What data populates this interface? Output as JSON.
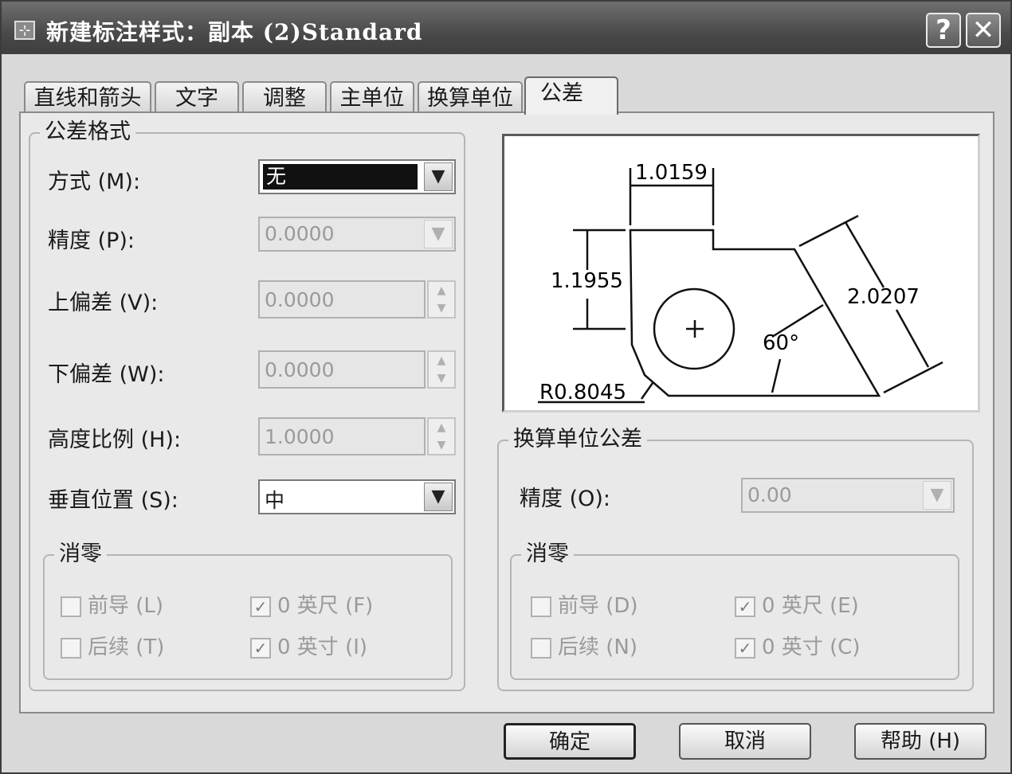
{
  "title": "新建标注样式：副本 (2)Standard",
  "title_icon": "dim-style-icon",
  "title_buttons": {
    "help": "?",
    "close": "✕"
  },
  "tabs": [
    {
      "label": "直线和箭头",
      "active": false
    },
    {
      "label": "文字",
      "active": false
    },
    {
      "label": "调整",
      "active": false
    },
    {
      "label": "主单位",
      "active": false
    },
    {
      "label": "换算单位",
      "active": false
    },
    {
      "label": "公差",
      "active": true
    }
  ],
  "tolerance_format": {
    "group_label": "公差格式",
    "method_label": "方式 (M):",
    "method_value": "无",
    "precision_label": "精度 (P):",
    "precision_value": "0.0000",
    "upper_label": "上偏差 (V):",
    "upper_value": "0.0000",
    "lower_label": "下偏差 (W):",
    "lower_value": "0.0000",
    "height_label": "高度比例 (H):",
    "height_value": "1.0000",
    "vertical_label": "垂直位置 (S):",
    "vertical_value": "中",
    "zero_group_label": "消零",
    "leading_label": "前导 (L)",
    "leading_checked": false,
    "trailing_label": "后续 (T)",
    "trailing_checked": false,
    "feet_label": "0 英尺 (F)",
    "feet_checked": true,
    "inches_label": "0 英寸 (I)",
    "inches_checked": true
  },
  "preview": {
    "dim_top": "1.0159",
    "dim_left": "1.1955",
    "dim_diag": "2.0207",
    "dim_angle": "60°",
    "dim_radius": "R0.8045"
  },
  "alt_tolerance": {
    "group_label": "换算单位公差",
    "precision_label": "精度 (O):",
    "precision_value": "0.00",
    "zero_group_label": "消零",
    "leading_label": "前导 (D)",
    "leading_checked": false,
    "trailing_label": "后续 (N)",
    "trailing_checked": false,
    "feet_label": "0 英尺 (E)",
    "feet_checked": true,
    "inches_label": "0 英寸 (C)",
    "inches_checked": true
  },
  "buttons": {
    "ok": "确定",
    "cancel": "取消",
    "help": "帮助 (H)"
  }
}
